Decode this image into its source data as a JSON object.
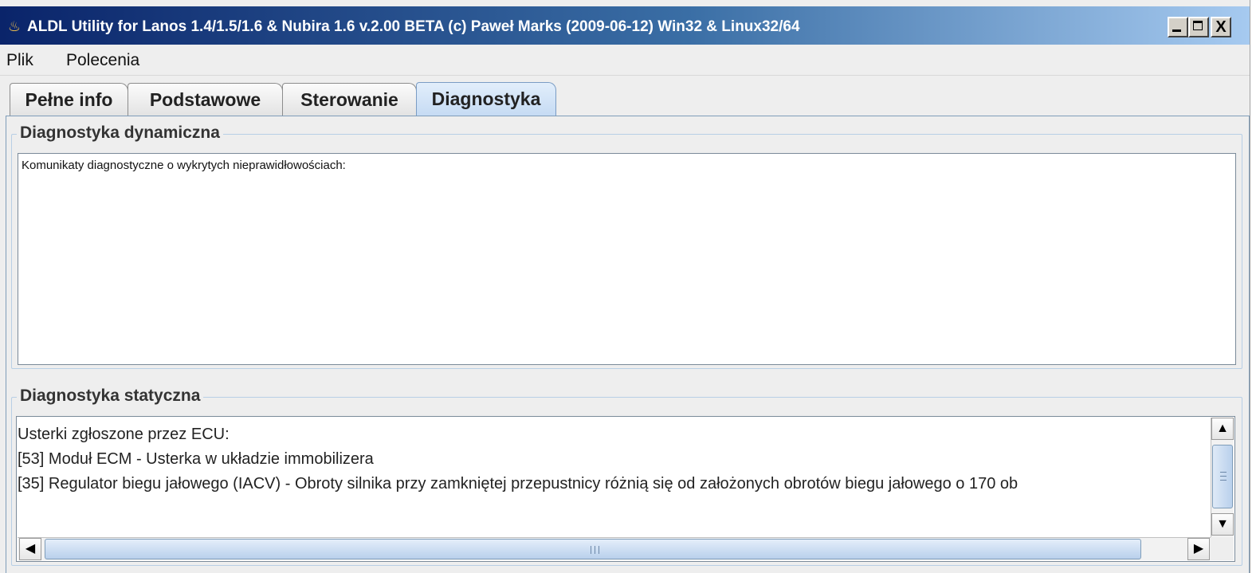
{
  "window": {
    "title": "ALDL Utility for Lanos 1.4/1.5/1.6 & Nubira 1.6  v.2.00 BETA (c) Paweł Marks (2009-06-12) Win32 & Linux32/64",
    "icon": "java-icon",
    "controls": {
      "minimize": "minimize-icon",
      "maximize": "maximize-icon",
      "close": "X"
    }
  },
  "menu": {
    "items": [
      {
        "label": "Plik"
      },
      {
        "label": "Polecenia"
      }
    ]
  },
  "tabs": [
    {
      "label": "Pełne info",
      "active": false
    },
    {
      "label": "Podstawowe",
      "active": false
    },
    {
      "label": "Sterowanie",
      "active": false
    },
    {
      "label": "Diagnostyka",
      "active": true
    }
  ],
  "dynamic": {
    "title": "Diagnostyka dynamiczna",
    "text": "Komunikaty diagnostyczne o wykrytych nieprawidłowościach:"
  },
  "static": {
    "title": "Diagnostyka statyczna",
    "lines": [
      "Usterki zgłoszone przez ECU:",
      "[53] Moduł ECM - Usterka w układzie immobilizera",
      "[35] Regulator biegu jałowego (IACV) - Obroty silnika przy zamkniętej przepustnicy różnią się od założonych obrotów biegu jałowego o 170 ob"
    ]
  },
  "scrollbars": {
    "up": "▲",
    "down": "▼",
    "left": "◀",
    "right": "▶"
  },
  "colors": {
    "title_gradient_start": "#0a246a",
    "title_gradient_end": "#a6caf0",
    "active_tab": "#c4daf3",
    "panel_border": "#7f9db9"
  }
}
